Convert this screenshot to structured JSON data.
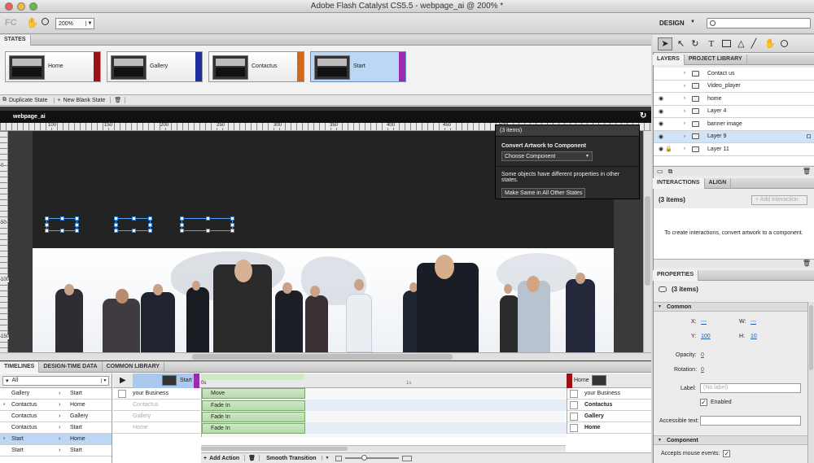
{
  "window": {
    "title": "Adobe Flash Catalyst CS5.5 - webpage_ai @ 200% *"
  },
  "toolbar": {
    "zoom": "200%",
    "workspace": "DESIGN",
    "logo": "FC"
  },
  "states_panel": {
    "tab": "STATES",
    "states": [
      {
        "label": "Home",
        "color": "#9b1116"
      },
      {
        "label": "Gallery",
        "color": "#1f2e9e"
      },
      {
        "label": "Contactus",
        "color": "#d5671a"
      },
      {
        "label": "Start",
        "color": "#9a2bb0"
      }
    ],
    "duplicate_label": "Duplicate State",
    "new_blank_label": "New Blank State"
  },
  "stage": {
    "doc_tab": "webpage_ai",
    "ruler_marks": [
      "100",
      "150",
      "200",
      "250",
      "300",
      "350",
      "400",
      "450",
      "500"
    ],
    "vruler_marks": [
      "0",
      "50",
      "100",
      "150"
    ]
  },
  "popup": {
    "title": "(3 items)",
    "convert_heading": "Convert Artwork to Component",
    "choose_component": "Choose Component",
    "message": "Some objects have different properties in other states.",
    "make_same": "Make Same in All Other States"
  },
  "timelines": {
    "tabs": [
      "TIMELINES",
      "DESIGN-TIME DATA",
      "COMMON LIBRARY"
    ],
    "filter": "All",
    "transitions": [
      {
        "from": "Gallery",
        "to": "Start"
      },
      {
        "from": "Contactus",
        "to": "Home"
      },
      {
        "from": "Contactus",
        "to": "Gallery"
      },
      {
        "from": "Contactus",
        "to": "Start"
      },
      {
        "from": "Start",
        "to": "Home"
      },
      {
        "from": "Start",
        "to": "Start"
      }
    ],
    "start_state": "Start",
    "end_state": "Home",
    "time_0": "0s",
    "time_1": "1s",
    "objects": [
      "your Business",
      "Contactus",
      "Gallery",
      "Home"
    ],
    "actions": [
      "Move",
      "Fade In",
      "Fade In",
      "Fade In"
    ],
    "end_objects": [
      "your Business",
      "Contactus",
      "Gallery",
      "Home"
    ],
    "add_action": "Add Action",
    "smooth_transition": "Smooth Transition"
  },
  "layers_panel": {
    "tabs": [
      "LAYERS",
      "PROJECT LIBRARY"
    ],
    "layers": [
      {
        "name": "Contact us"
      },
      {
        "name": "Video_player"
      },
      {
        "name": "home"
      },
      {
        "name": "Layer 4"
      },
      {
        "name": "banner image"
      },
      {
        "name": "Layer 9"
      },
      {
        "name": "Layer 11"
      }
    ]
  },
  "interactions_panel": {
    "tabs": [
      "INTERACTIONS",
      "ALIGN"
    ],
    "title": "(3 items)",
    "add_label": "Add Interaction",
    "hint": "To create interactions, convert artwork to a component."
  },
  "properties_panel": {
    "tab": "PROPERTIES",
    "title": "(3 items)",
    "common": "Common",
    "x_label": "X:",
    "x_value": "---",
    "w_label": "W:",
    "w_value": "---",
    "y_label": "Y:",
    "y_value": "100",
    "h_label": "H:",
    "h_value": "10",
    "opacity_label": "Opacity:",
    "opacity_value": "0",
    "rotation_label": "Rotation:",
    "rotation_value": "0",
    "label_label": "Label:",
    "label_placeholder": "(No label)",
    "enabled": "Enabled",
    "accessible_label": "Accessible text:",
    "component": "Component",
    "mouse_events": "Accepts mouse events:"
  }
}
